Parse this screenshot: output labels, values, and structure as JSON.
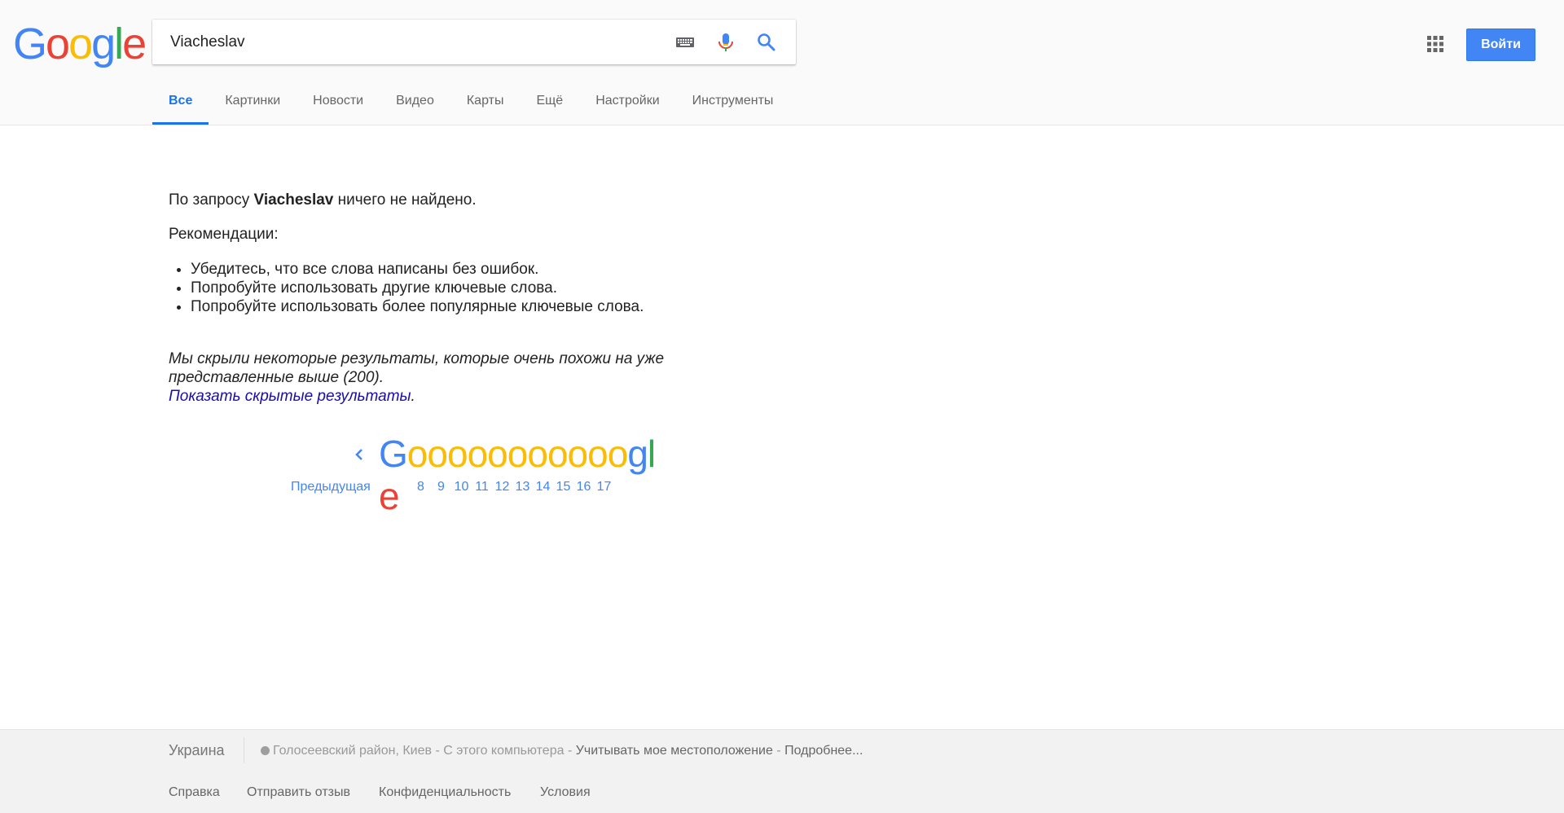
{
  "header": {
    "logo_letters": [
      {
        "ch": "G",
        "color": "#4285F4"
      },
      {
        "ch": "o",
        "color": "#EA4335"
      },
      {
        "ch": "o",
        "color": "#FBBC05"
      },
      {
        "ch": "g",
        "color": "#4285F4"
      },
      {
        "ch": "l",
        "color": "#34A853"
      },
      {
        "ch": "e",
        "color": "#EA4335"
      }
    ],
    "search_value": "Viacheslav",
    "signin_label": "Войти",
    "icons": {
      "keyboard": "keyboard-icon",
      "mic": "mic-icon",
      "search": "search-icon",
      "apps": "apps-grid-icon"
    }
  },
  "tabs": [
    {
      "label": "Все",
      "active": true
    },
    {
      "label": "Картинки"
    },
    {
      "label": "Новости"
    },
    {
      "label": "Видео"
    },
    {
      "label": "Карты"
    },
    {
      "label": "Ещё"
    },
    {
      "label": "Настройки"
    },
    {
      "label": "Инструменты"
    }
  ],
  "results": {
    "no_results_prefix": "По запросу ",
    "query": "Viacheslav",
    "no_results_suffix": " ничего не найдено.",
    "recommendations_title": "Рекомендации:",
    "suggestions": [
      "Убедитесь, что все слова написаны без ошибок.",
      "Попробуйте использовать другие ключевые слова.",
      "Попробуйте использовать более популярные ключевые слова."
    ],
    "omitted_text": "Мы скрыли некоторые результаты, которые очень похожи на уже представленные выше (200).",
    "show_hidden_link": "Показать скрытые результаты",
    "show_hidden_suffix": "."
  },
  "pagination": {
    "prev_label": "Предыдущая",
    "pages": [
      "8",
      "9",
      "10",
      "11",
      "12",
      "13",
      "14",
      "15",
      "16",
      "17"
    ],
    "logo_letters": [
      {
        "ch": "G",
        "color": "#4285F4"
      },
      {
        "ch": "o",
        "color": "#FBBC05"
      },
      {
        "ch": "o",
        "color": "#FBBC05"
      },
      {
        "ch": "o",
        "color": "#FBBC05"
      },
      {
        "ch": "o",
        "color": "#FBBC05"
      },
      {
        "ch": "o",
        "color": "#FBBC05"
      },
      {
        "ch": "o",
        "color": "#FBBC05"
      },
      {
        "ch": "o",
        "color": "#FBBC05"
      },
      {
        "ch": "o",
        "color": "#FBBC05"
      },
      {
        "ch": "o",
        "color": "#FBBC05"
      },
      {
        "ch": "o",
        "color": "#FBBC05"
      },
      {
        "ch": "o",
        "color": "#FBBC05"
      },
      {
        "ch": "g",
        "color": "#4285F4"
      },
      {
        "ch": "l",
        "color": "#34A853"
      },
      {
        "ch": "e",
        "color": "#EA4335"
      }
    ]
  },
  "footer": {
    "country": "Украина",
    "location": "Голосеевский район, Киев",
    "location_sep1": " - ",
    "location_source": "С этого компьютера",
    "location_sep2": " - ",
    "use_location": "Учитывать мое местоположение",
    "location_sep3": " - ",
    "more": "Подробнее...",
    "links": [
      "Справка",
      "Отправить отзыв",
      "Конфиденциальность",
      "Условия"
    ]
  },
  "colors": {
    "accent": "#1a73e8",
    "signin": "#4285f4",
    "link_visited": "#1a0dab"
  }
}
